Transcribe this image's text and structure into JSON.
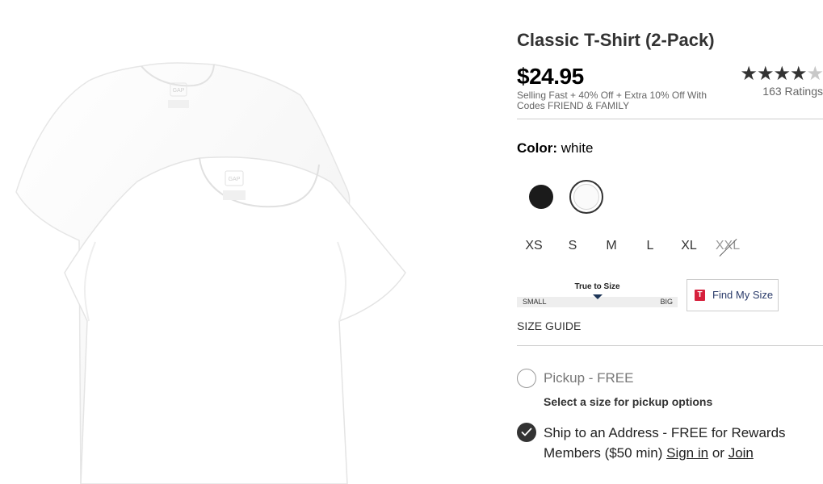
{
  "product": {
    "title": "Classic T-Shirt (2-Pack)",
    "price": "$24.95",
    "promo": "Selling Fast + 40% Off + Extra 10% Off With Codes FRIEND & FAMILY",
    "rating_value": 4,
    "rating_max": 5,
    "rating_count": "163 Ratings",
    "image_logo_text": "GAP"
  },
  "color": {
    "label": "Color:",
    "selected": "white",
    "swatches": [
      {
        "name": "black",
        "hex": "#1b1b1b"
      },
      {
        "name": "white",
        "hex": "#fafafa"
      }
    ]
  },
  "sizes": [
    {
      "label": "XS",
      "available": true
    },
    {
      "label": "S",
      "available": true
    },
    {
      "label": "M",
      "available": true
    },
    {
      "label": "L",
      "available": true
    },
    {
      "label": "XL",
      "available": true
    },
    {
      "label": "XXL",
      "available": false
    }
  ],
  "fit": {
    "label": "True to Size",
    "small": "SMALL",
    "big": "BIG"
  },
  "find_my_size": {
    "logo": "T",
    "label": "Find My Size"
  },
  "size_guide": "SIZE GUIDE",
  "fulfillment": {
    "pickup_label": "Pickup - FREE",
    "pickup_note": "Select a size for pickup options",
    "ship_label": "Ship to an Address - FREE for Rewards Members ($50 min)",
    "sign_in": "Sign in",
    "or": "or",
    "join": "Join"
  },
  "colors": {
    "text": "#333333",
    "price": "#000000",
    "brand_red": "#d6203c",
    "navy": "#2a3b6a"
  }
}
